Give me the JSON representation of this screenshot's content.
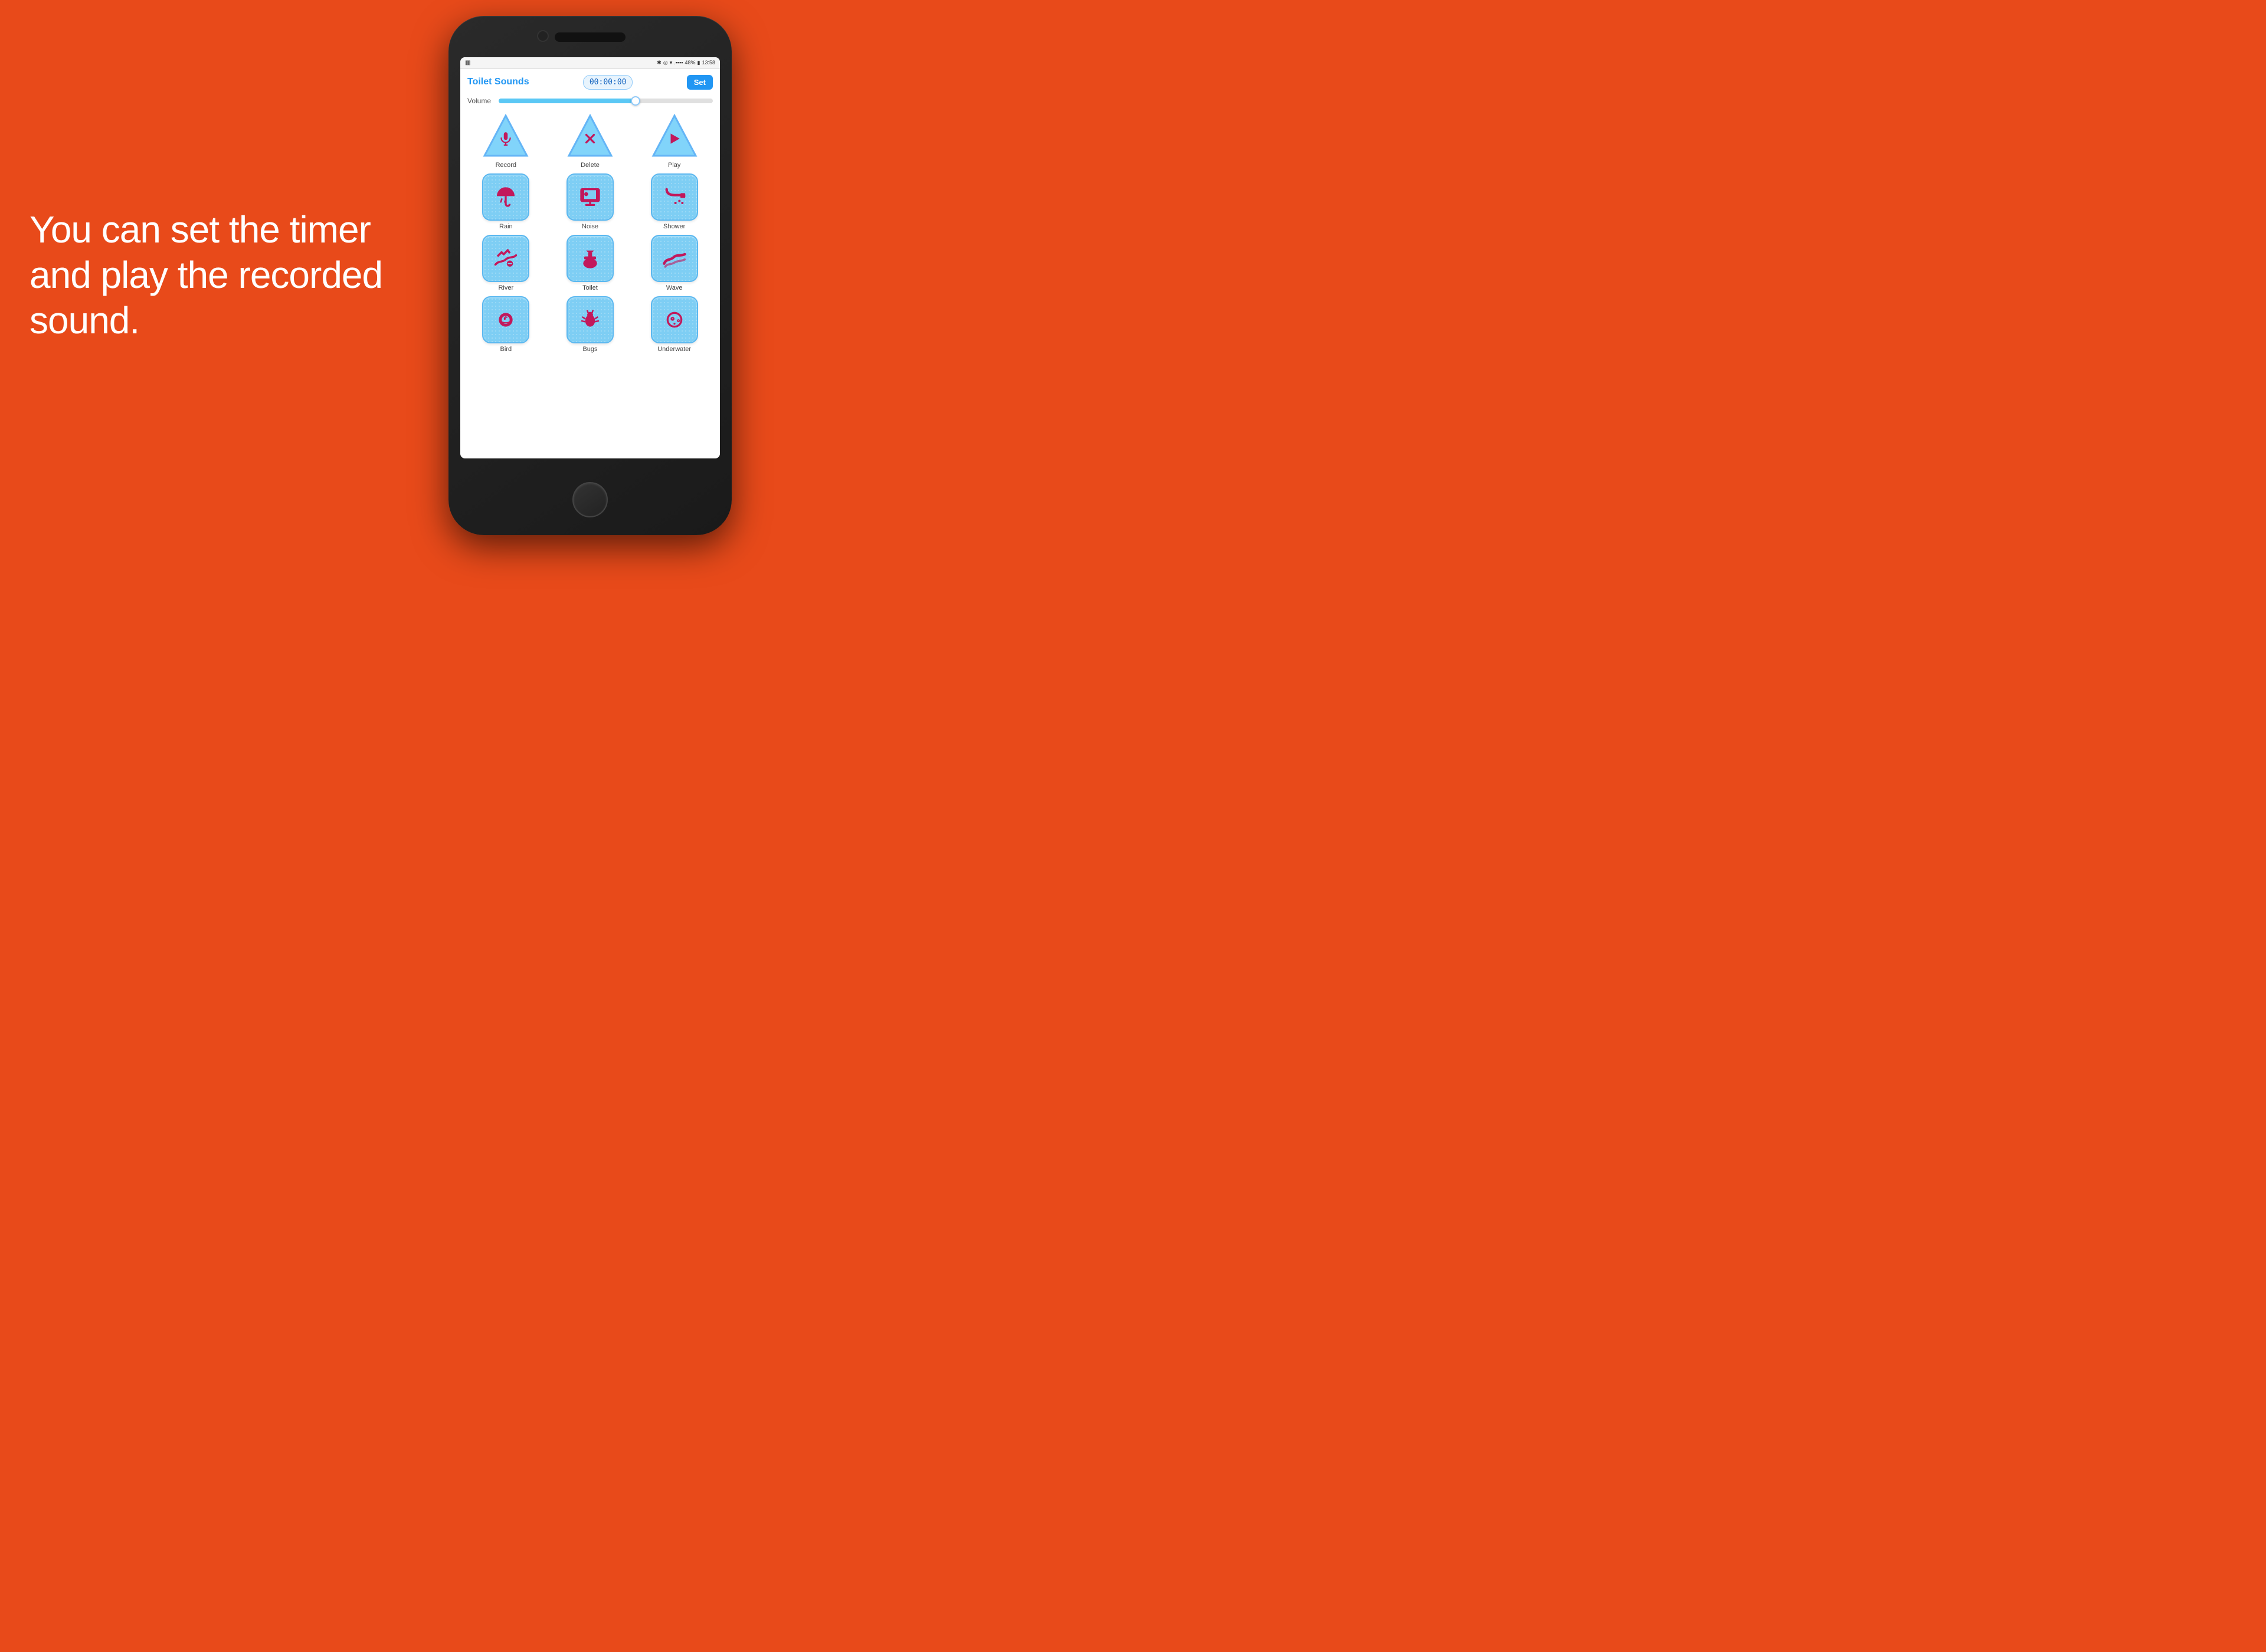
{
  "page": {
    "background_color": "#E84A1A",
    "headline": "You can set the timer and play the recorded sound."
  },
  "status_bar": {
    "left_icon": "menu-icon",
    "bluetooth": "BT",
    "signal_icons": "* ◎ ▾",
    "battery_percent": "48%",
    "time": "13:58"
  },
  "app": {
    "title": "Toilet Sounds",
    "timer": "00:00:00",
    "set_button": "Set",
    "volume_label": "Volume"
  },
  "sounds": [
    {
      "id": "record",
      "label": "Record",
      "shape": "triangle",
      "icon": "mic"
    },
    {
      "id": "delete",
      "label": "Delete",
      "shape": "triangle",
      "icon": "x"
    },
    {
      "id": "play",
      "label": "Play",
      "shape": "triangle",
      "icon": "play"
    },
    {
      "id": "rain",
      "label": "Rain",
      "shape": "square",
      "icon": "umbrella"
    },
    {
      "id": "noise",
      "label": "Noise",
      "shape": "square",
      "icon": "monitor"
    },
    {
      "id": "shower",
      "label": "Shower",
      "shape": "square",
      "icon": "shower"
    },
    {
      "id": "river",
      "label": "River",
      "shape": "square",
      "icon": "river"
    },
    {
      "id": "toilet",
      "label": "Toilet",
      "shape": "square",
      "icon": "toilet"
    },
    {
      "id": "wave",
      "label": "Wave",
      "shape": "square",
      "icon": "wave"
    },
    {
      "id": "bird",
      "label": "Bird",
      "shape": "square",
      "icon": "bird"
    },
    {
      "id": "bugs",
      "label": "Bugs",
      "shape": "square",
      "icon": "bugs"
    },
    {
      "id": "underwater",
      "label": "Underwater",
      "shape": "square",
      "icon": "underwater"
    }
  ]
}
